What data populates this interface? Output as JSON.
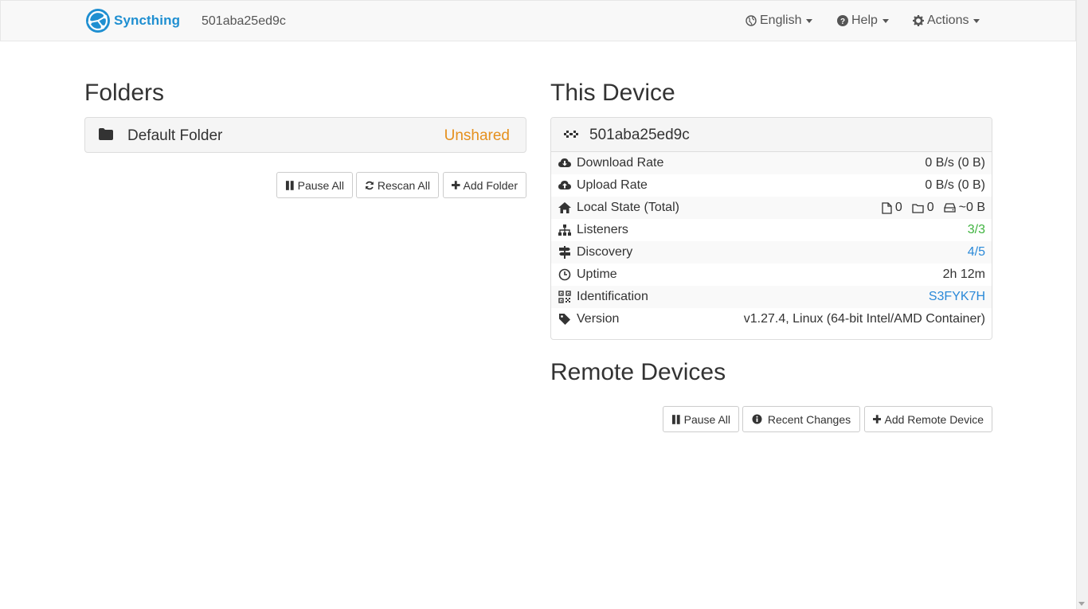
{
  "navbar": {
    "brand": "Syncthing",
    "device_name": "501aba25ed9c",
    "language_label": "English",
    "help_label": "Help",
    "actions_label": "Actions"
  },
  "folders": {
    "title": "Folders",
    "items": [
      {
        "label": "Default Folder",
        "status": "Unshared"
      }
    ],
    "buttons": {
      "pause_all": "Pause All",
      "rescan_all": "Rescan All",
      "add_folder": "Add Folder"
    }
  },
  "this_device": {
    "title": "This Device",
    "name": "501aba25ed9c",
    "rows": [
      {
        "label": "Download Rate",
        "value": "0 B/s (0 B)"
      },
      {
        "label": "Upload Rate",
        "value": "0 B/s (0 B)"
      },
      {
        "label": "Local State (Total)",
        "files": "0",
        "dirs": "0",
        "size": "~0 B"
      },
      {
        "label": "Listeners",
        "value": "3/3"
      },
      {
        "label": "Discovery",
        "value": "4/5"
      },
      {
        "label": "Uptime",
        "value": "2h 12m"
      },
      {
        "label": "Identification",
        "value": "S3FYK7H"
      },
      {
        "label": "Version",
        "value": "v1.27.4, Linux (64-bit Intel/AMD Container)"
      }
    ]
  },
  "remote_devices": {
    "title": "Remote Devices",
    "buttons": {
      "pause_all": "Pause All",
      "recent_changes": "Recent Changes",
      "add_remote_device": "Add Remote Device"
    }
  },
  "colors": {
    "brand": "#1f8fd1",
    "unshared": "#e5901d",
    "ok_green": "#3fb33f",
    "link_blue": "#2a89d8"
  }
}
